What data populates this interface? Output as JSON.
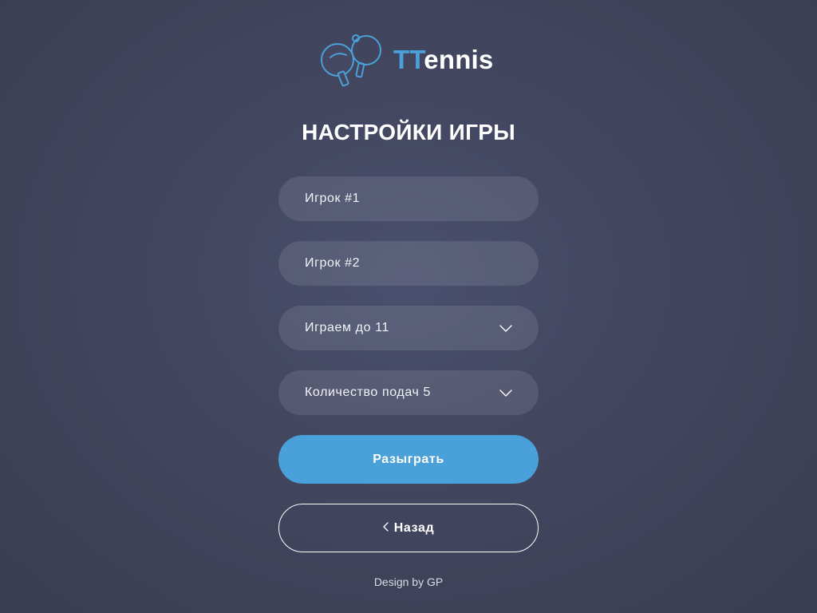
{
  "logo": {
    "accent_text": "TT",
    "rest_text": "ennis",
    "icon": "ping-pong-paddles-icon",
    "accent_color": "#4aa0d8"
  },
  "title": "НАСТРОЙКИ ИГРЫ",
  "form": {
    "player1_placeholder": "Игрок #1",
    "player2_placeholder": "Игрок #2",
    "points_select": "Играем до 11",
    "serves_select": "Количество подач 5",
    "start_button": "Разыграть",
    "back_button": "Назад"
  },
  "footer": "Design by GP",
  "colors": {
    "background": "#42465f",
    "primary": "#4aa0d8",
    "field": "#545872"
  }
}
